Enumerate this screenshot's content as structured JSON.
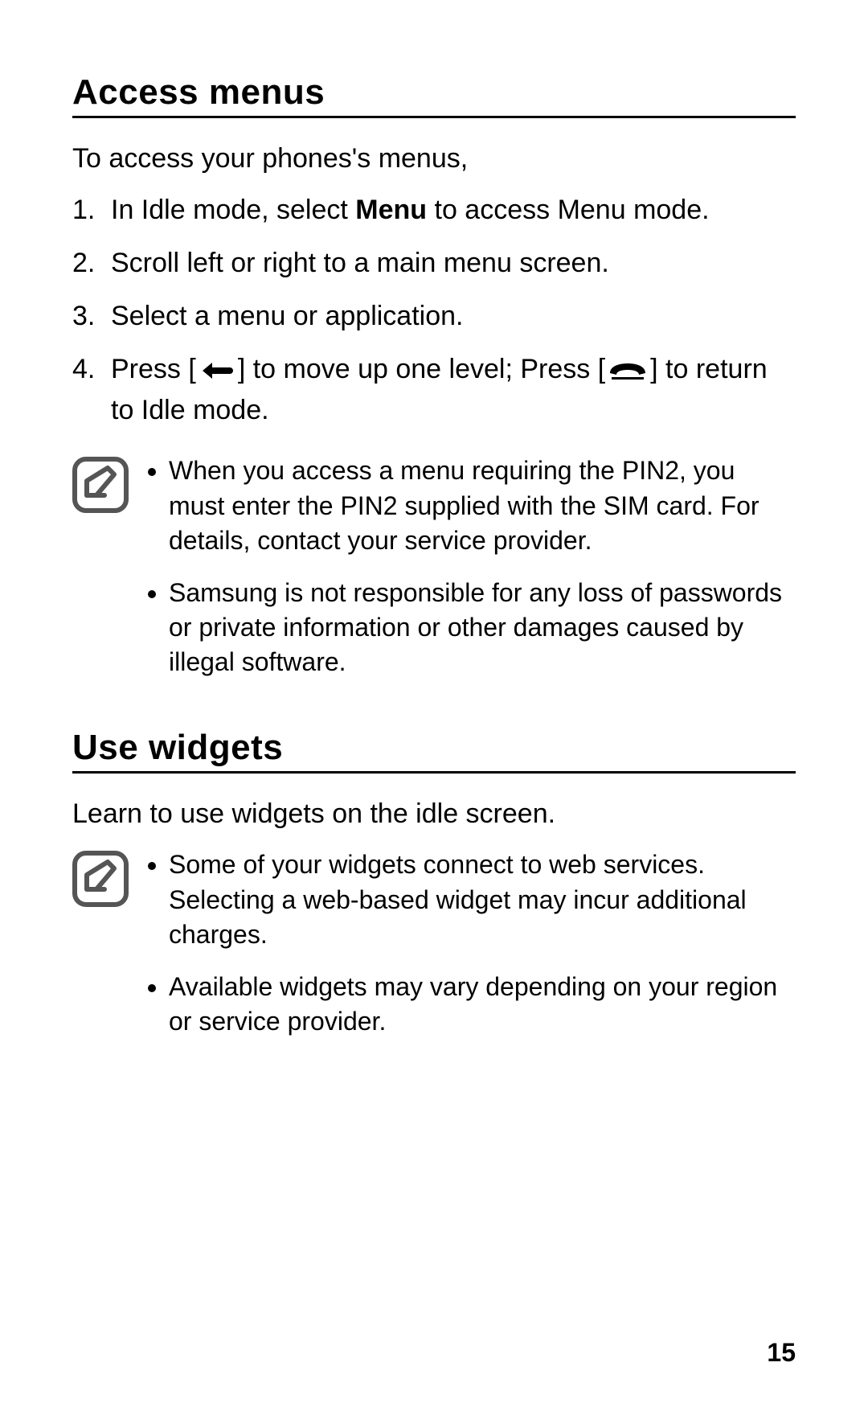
{
  "page_number": "15",
  "section1": {
    "heading": "Access menus",
    "intro": "To access your phones's menus,",
    "steps": {
      "s1_pre": "In Idle mode, select ",
      "s1_bold": "Menu",
      "s1_post": " to access Menu mode.",
      "s2": "Scroll left or right to a main menu screen.",
      "s3": "Select a menu or application.",
      "s4_a": "Press [",
      "s4_b": "] to move up one level; Press [",
      "s4_c": "] to return to Idle mode."
    },
    "note": {
      "b1": "When you access a menu requiring the PIN2, you must enter the PIN2 supplied with the SIM card. For details, contact your service provider.",
      "b2": "Samsung is not responsible for any loss of passwords or private information or other damages caused by illegal software."
    }
  },
  "section2": {
    "heading": "Use widgets",
    "intro": "Learn to use widgets on the idle screen.",
    "note": {
      "b1": "Some of your widgets connect to web services. Selecting a web-based widget may incur additional charges.",
      "b2": "Available widgets may vary depending on your region or service provider."
    }
  }
}
